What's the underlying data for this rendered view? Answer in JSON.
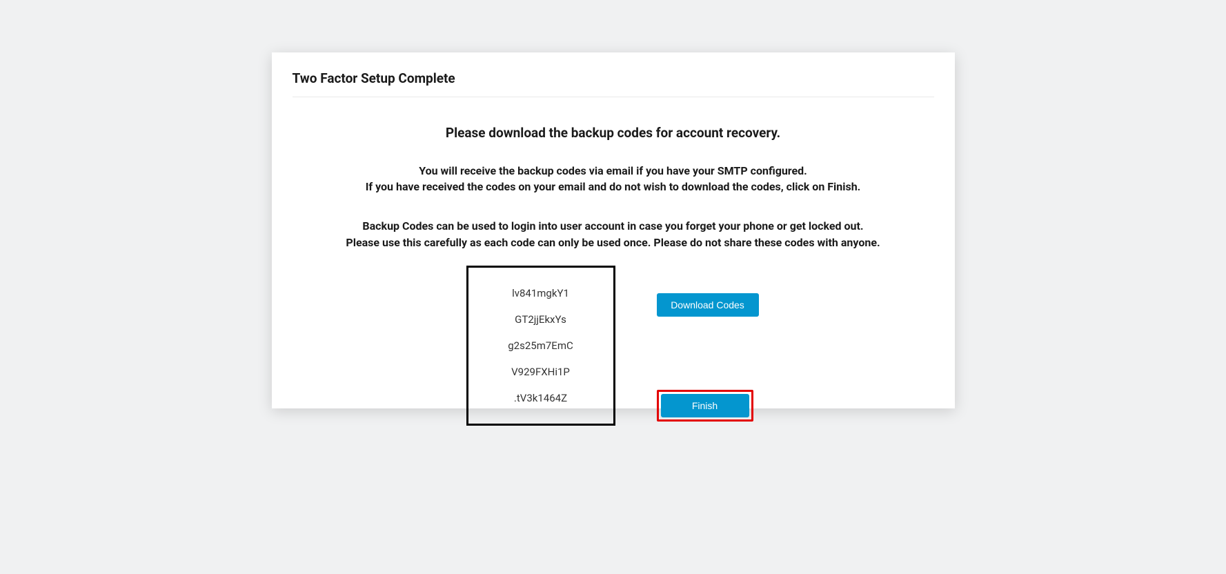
{
  "card": {
    "title": "Two Factor Setup Complete",
    "main_instruction": "Please download the backup codes for account recovery.",
    "para1_line1": "You will receive the backup codes via email if you have your SMTP configured.",
    "para1_line2": "If you have received the codes on your email and do not wish to download the codes, click on Finish.",
    "para2_line1": "Backup Codes can be used to login into user account in case you forget your phone or get locked out.",
    "para2_line2": "Please use this carefully as each code can only be used once. Please do not share these codes with anyone."
  },
  "codes": {
    "item0": "lv841mgkY1",
    "item1": "GT2jjEkxYs",
    "item2": "g2s25m7EmC",
    "item3": "V929FXHi1P",
    "item4": ".tV3k1464Z"
  },
  "buttons": {
    "download": "Download Codes",
    "finish": "Finish"
  }
}
